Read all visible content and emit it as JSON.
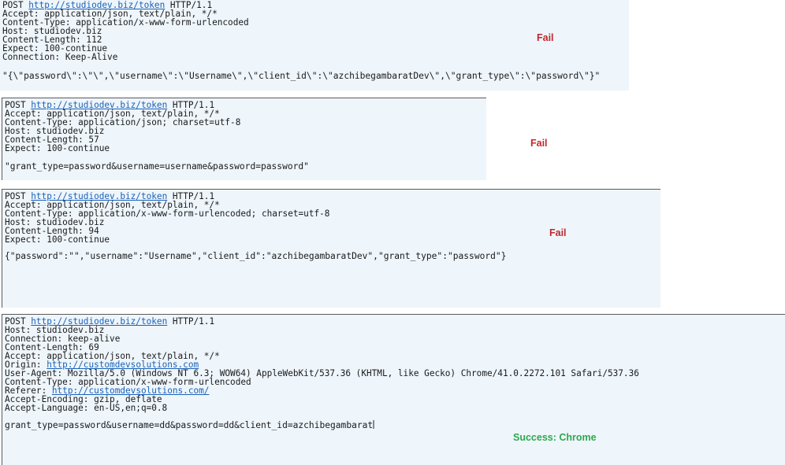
{
  "colors": {
    "panel_bg": "#eef5fb",
    "link": "#1a62b8",
    "fail": "#c0282e",
    "success": "#2fa84f"
  },
  "panel1": {
    "method": "POST",
    "url": "http://studiodev.biz/token",
    "protocol": "HTTP/1.1",
    "headers": [
      "Accept: application/json, text/plain, */*",
      "Content-Type: application/x-www-form-urlencoded",
      "Host: studiodev.biz",
      "Content-Length: 112",
      "Expect: 100-continue",
      "Connection: Keep-Alive"
    ],
    "body": "\"{\\\"password\\\":\\\"\\\",\\\"username\\\":\\\"Username\\\",\\\"client_id\\\":\\\"azchibegambaratDev\\\",\\\"grant_type\\\":\\\"password\\\"}\"",
    "status": "Fail"
  },
  "panel2": {
    "method": "POST",
    "url": "http://studiodev.biz/token",
    "protocol": "HTTP/1.1",
    "headers": [
      "Accept: application/json, text/plain, */*",
      "Content-Type: application/json; charset=utf-8",
      "Host: studiodev.biz",
      "Content-Length: 57",
      "Expect: 100-continue"
    ],
    "body": "\"grant_type=password&username=username&password=password\"",
    "status": "Fail"
  },
  "panel3": {
    "method": "POST",
    "url": "http://studiodev.biz/token",
    "protocol": "HTTP/1.1",
    "headers": [
      "Accept: application/json, text/plain, */*",
      "Content-Type: application/x-www-form-urlencoded; charset=utf-8",
      "Host: studiodev.biz",
      "Content-Length: 94",
      "Expect: 100-continue"
    ],
    "body": "{\"password\":\"\",\"username\":\"Username\",\"client_id\":\"azchibegambaratDev\",\"grant_type\":\"password\"}",
    "status": "Fail"
  },
  "panel4": {
    "method": "POST",
    "url": "http://studiodev.biz/token",
    "protocol": "HTTP/1.1",
    "headers_a": [
      "Host: studiodev.biz",
      "Connection: keep-alive",
      "Content-Length: 69",
      "Accept: application/json, text/plain, */*"
    ],
    "origin_label": "Origin: ",
    "origin_url": "http://customdevsolutions.com",
    "headers_b": [
      "User-Agent: Mozilla/5.0 (Windows NT 6.3; WOW64) AppleWebKit/537.36 (KHTML, like Gecko) Chrome/41.0.2272.101 Safari/537.36",
      "Content-Type: application/x-www-form-urlencoded"
    ],
    "referer_label": "Referer: ",
    "referer_url": "http://customdevsolutions.com/",
    "headers_c": [
      "Accept-Encoding: gzip, deflate",
      "Accept-Language: en-US,en;q=0.8"
    ],
    "body": "grant_type=password&username=dd&password=dd&client_id=azchibegambarat",
    "status": "Success: Chrome"
  }
}
